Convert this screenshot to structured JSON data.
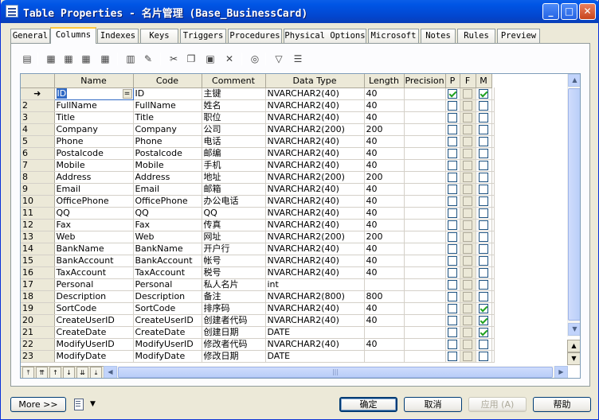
{
  "window": {
    "title": "Table Properties - 名片管理 (Base_BusinessCard)"
  },
  "titlebar_buttons": {
    "minimize": "_",
    "maximize": "□",
    "close": "✕"
  },
  "tabs": [
    "General",
    "Columns",
    "Indexes",
    "Keys",
    "Triggers",
    "Procedures",
    "Physical Options",
    "Microsoft",
    "Notes",
    "Rules",
    "Preview"
  ],
  "active_tab": "Columns",
  "toolbar_icons": [
    "properties-icon",
    "add-row-icon",
    "insert-row-icon",
    "add-rows-icon",
    "delete-rows-icon",
    "find-icon",
    "attribute-icon",
    "cut-icon",
    "copy-icon",
    "paste-icon",
    "delete-icon",
    "find-binoculars-icon",
    "filter-icon",
    "customize-columns-icon"
  ],
  "grid": {
    "headers": [
      "Name",
      "Code",
      "Comment",
      "Data Type",
      "Length",
      "Precision",
      "P",
      "F",
      "M"
    ],
    "rows": [
      {
        "num": "➜",
        "name": "ID",
        "code": "ID",
        "comment": "主键",
        "type": "NVARCHAR2(40)",
        "length": "40",
        "precision": "",
        "p": true,
        "f": false,
        "m": true
      },
      {
        "num": "2",
        "name": "FullName",
        "code": "FullName",
        "comment": "姓名",
        "type": "NVARCHAR2(40)",
        "length": "40",
        "precision": "",
        "p": false,
        "f": false,
        "m": false
      },
      {
        "num": "3",
        "name": "Title",
        "code": "Title",
        "comment": "职位",
        "type": "NVARCHAR2(40)",
        "length": "40",
        "precision": "",
        "p": false,
        "f": false,
        "m": false
      },
      {
        "num": "4",
        "name": "Company",
        "code": "Company",
        "comment": "公司",
        "type": "NVARCHAR2(200)",
        "length": "200",
        "precision": "",
        "p": false,
        "f": false,
        "m": false
      },
      {
        "num": "5",
        "name": "Phone",
        "code": "Phone",
        "comment": "电话",
        "type": "NVARCHAR2(40)",
        "length": "40",
        "precision": "",
        "p": false,
        "f": false,
        "m": false
      },
      {
        "num": "6",
        "name": "Postalcode",
        "code": "Postalcode",
        "comment": "邮编",
        "type": "NVARCHAR2(40)",
        "length": "40",
        "precision": "",
        "p": false,
        "f": false,
        "m": false
      },
      {
        "num": "7",
        "name": "Mobile",
        "code": "Mobile",
        "comment": "手机",
        "type": "NVARCHAR2(40)",
        "length": "40",
        "precision": "",
        "p": false,
        "f": false,
        "m": false
      },
      {
        "num": "8",
        "name": "Address",
        "code": "Address",
        "comment": "地址",
        "type": "NVARCHAR2(200)",
        "length": "200",
        "precision": "",
        "p": false,
        "f": false,
        "m": false
      },
      {
        "num": "9",
        "name": "Email",
        "code": "Email",
        "comment": "邮箱",
        "type": "NVARCHAR2(40)",
        "length": "40",
        "precision": "",
        "p": false,
        "f": false,
        "m": false
      },
      {
        "num": "10",
        "name": "OfficePhone",
        "code": "OfficePhone",
        "comment": "办公电话",
        "type": "NVARCHAR2(40)",
        "length": "40",
        "precision": "",
        "p": false,
        "f": false,
        "m": false
      },
      {
        "num": "11",
        "name": "QQ",
        "code": "QQ",
        "comment": "QQ",
        "type": "NVARCHAR2(40)",
        "length": "40",
        "precision": "",
        "p": false,
        "f": false,
        "m": false
      },
      {
        "num": "12",
        "name": "Fax",
        "code": "Fax",
        "comment": "传真",
        "type": "NVARCHAR2(40)",
        "length": "40",
        "precision": "",
        "p": false,
        "f": false,
        "m": false
      },
      {
        "num": "13",
        "name": "Web",
        "code": "Web",
        "comment": "网址",
        "type": "NVARCHAR2(200)",
        "length": "200",
        "precision": "",
        "p": false,
        "f": false,
        "m": false
      },
      {
        "num": "14",
        "name": "BankName",
        "code": "BankName",
        "comment": "开户行",
        "type": "NVARCHAR2(40)",
        "length": "40",
        "precision": "",
        "p": false,
        "f": false,
        "m": false
      },
      {
        "num": "15",
        "name": "BankAccount",
        "code": "BankAccount",
        "comment": "帐号",
        "type": "NVARCHAR2(40)",
        "length": "40",
        "precision": "",
        "p": false,
        "f": false,
        "m": false
      },
      {
        "num": "16",
        "name": "TaxAccount",
        "code": "TaxAccount",
        "comment": "税号",
        "type": "NVARCHAR2(40)",
        "length": "40",
        "precision": "",
        "p": false,
        "f": false,
        "m": false
      },
      {
        "num": "17",
        "name": "Personal",
        "code": "Personal",
        "comment": "私人名片",
        "type": "int",
        "length": "",
        "precision": "",
        "p": false,
        "f": false,
        "m": false
      },
      {
        "num": "18",
        "name": "Description",
        "code": "Description",
        "comment": "备注",
        "type": "NVARCHAR2(800)",
        "length": "800",
        "precision": "",
        "p": false,
        "f": false,
        "m": false
      },
      {
        "num": "19",
        "name": "SortCode",
        "code": "SortCode",
        "comment": "排序码",
        "type": "NVARCHAR2(40)",
        "length": "40",
        "precision": "",
        "p": false,
        "f": false,
        "m": true
      },
      {
        "num": "20",
        "name": "CreateUserID",
        "code": "CreateUserID",
        "comment": "创建者代码",
        "type": "NVARCHAR2(40)",
        "length": "40",
        "precision": "",
        "p": false,
        "f": false,
        "m": true
      },
      {
        "num": "21",
        "name": "CreateDate",
        "code": "CreateDate",
        "comment": "创建日期",
        "type": "DATE",
        "length": "",
        "precision": "",
        "p": false,
        "f": false,
        "m": true
      },
      {
        "num": "22",
        "name": "ModifyUserID",
        "code": "ModifyUserID",
        "comment": "修改者代码",
        "type": "NVARCHAR2(40)",
        "length": "40",
        "precision": "",
        "p": false,
        "f": false,
        "m": false
      },
      {
        "num": "23",
        "name": "ModifyDate",
        "code": "ModifyDate",
        "comment": "修改日期",
        "type": "DATE",
        "length": "",
        "precision": "",
        "p": false,
        "f": false,
        "m": false
      }
    ],
    "selected_cell_button": "="
  },
  "nav_buttons": [
    "⤒",
    "⇈",
    "↑",
    "↓",
    "⇊",
    "⤓"
  ],
  "bottom": {
    "more": "More >>",
    "ok": "确定",
    "cancel": "取消",
    "apply": "应用 (A)",
    "help": "帮助"
  }
}
